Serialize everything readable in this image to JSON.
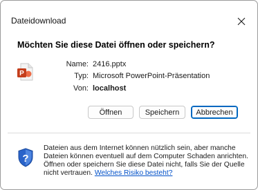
{
  "window": {
    "title": "Dateidownload",
    "close_icon": "close-icon"
  },
  "prompt": {
    "question": "Möchten Sie diese Datei öffnen oder speichern?"
  },
  "file": {
    "icon": "powerpoint-file-icon",
    "name_label": "Name:",
    "name_value": "2416.pptx",
    "type_label": "Typ:",
    "type_value": "Microsoft PowerPoint-Präsentation",
    "from_label": "Von:",
    "from_value": "localhost"
  },
  "buttons": {
    "open_label": "Öffnen",
    "save_label": "Speichern",
    "cancel_label": "Abbrechen"
  },
  "warning": {
    "icon": "security-shield-icon",
    "text": "Dateien aus dem Internet können nützlich sein, aber manche Dateien können eventuell auf dem Computer Schaden anrichten. Öffnen oder speichern Sie diese Datei nicht, falls Sie der Quelle nicht vertrauen.",
    "link_text": "Welches Risiko besteht?"
  },
  "colors": {
    "accent": "#0067c0",
    "powerpoint": "#d24726",
    "link": "#0050c8"
  }
}
